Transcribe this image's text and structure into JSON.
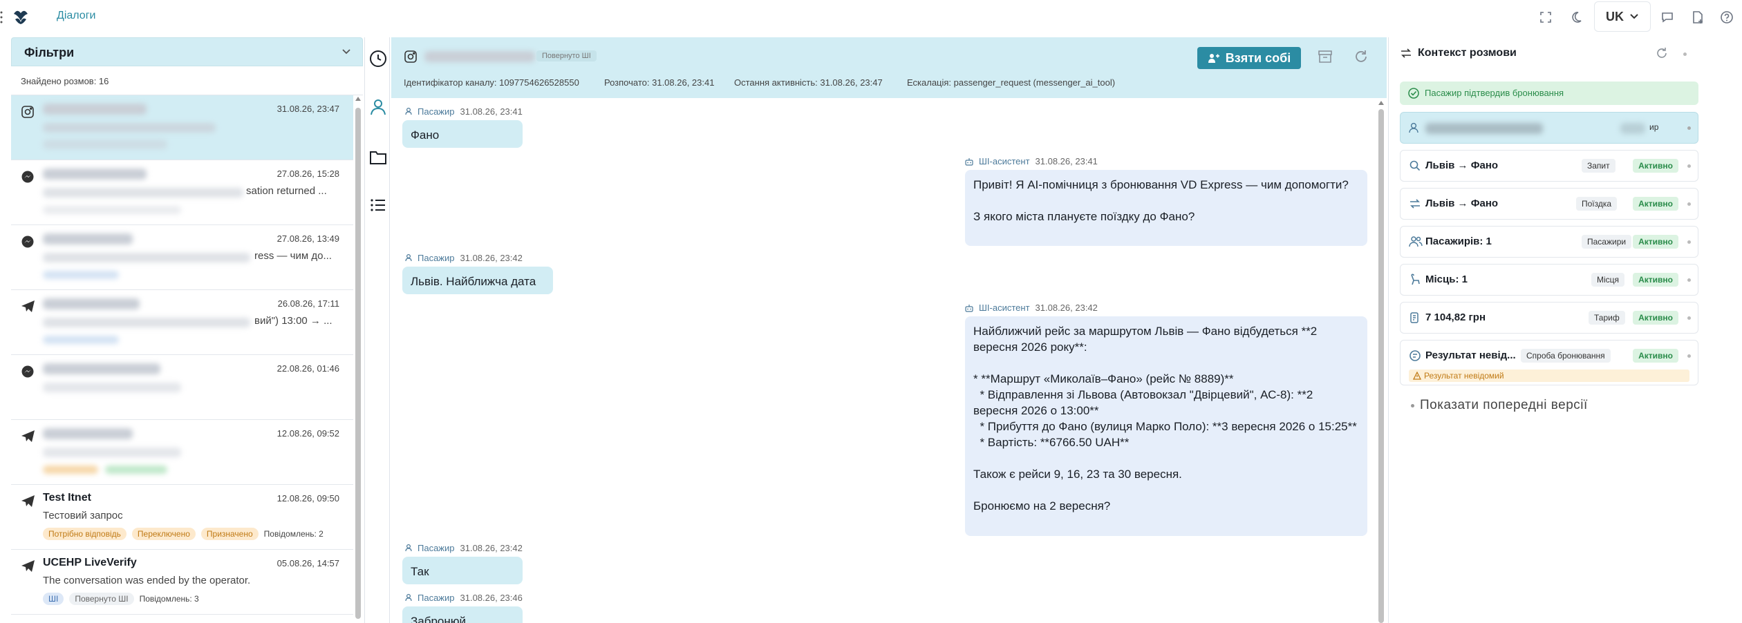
{
  "topbar": {
    "nav_label": "Діалоги",
    "lang": "UK"
  },
  "filters": {
    "title": "Фільтри",
    "found": "Знайдено розмов: 16"
  },
  "conversations": [
    {
      "name": "",
      "date": "31.08.26, 23:47",
      "preview": "",
      "channel": "instagram-icon"
    },
    {
      "name": "",
      "date": "27.08.26, 15:28",
      "preview": "sation returned ...",
      "channel": "messenger-icon"
    },
    {
      "name": "",
      "date": "27.08.26, 13:49",
      "preview": "ress — чим до...",
      "channel": "messenger-icon"
    },
    {
      "name": "",
      "date": "26.08.26, 17:11",
      "preview": "вий\") 13:00 → ...",
      "channel": "telegram-icon"
    },
    {
      "name": "",
      "date": "22.08.26, 01:46",
      "preview": "",
      "channel": "messenger-icon"
    },
    {
      "name": "",
      "date": "12.08.26, 09:52",
      "preview": "",
      "channel": "telegram-icon"
    },
    {
      "name": "Test Itnet",
      "date": "12.08.26, 09:50",
      "preview": "Тестовий запрос",
      "channel": "telegram-icon",
      "tags": [
        "Потрібно відповідь",
        "Переключено",
        "Призначено"
      ],
      "messages": "Повідомлень: 2"
    },
    {
      "name": "UCEHP LiveVerify",
      "date": "05.08.26, 14:57",
      "preview": "The conversation was ended by the operator.",
      "channel": "telegram-icon",
      "tags": [
        "ШІ",
        "Повернуто ШІ"
      ],
      "messages": "Повідомлень: 3"
    }
  ],
  "chat": {
    "returned_badge": "Повернуто ШІ",
    "take_button": "Взяти собі",
    "meta": {
      "channel_id": "Ідентифікатор каналу: 1097754626528550",
      "started": "Розпочато: 31.08.26, 23:41",
      "last_activity": "Остання активність: 31.08.26, 23:47",
      "escalation": "Ескалація: passenger_request (messenger_ai_tool)"
    },
    "messages": [
      {
        "role": "passenger",
        "sender": "Пасажир",
        "time": "31.08.26, 23:41",
        "text": "Фано"
      },
      {
        "role": "ai",
        "sender": "ШІ-асистент",
        "time": "31.08.26, 23:41",
        "text": "Привіт! Я AI-помічниця з бронювання VD Express — чим допомогти?\n\nЗ якого міста плануєте поїздку до Фано?"
      },
      {
        "role": "passenger",
        "sender": "Пасажир",
        "time": "31.08.26, 23:42",
        "text": "Львів. Найближча дата"
      },
      {
        "role": "ai",
        "sender": "ШІ-асистент",
        "time": "31.08.26, 23:42",
        "text": "Найближчий рейс за маршрутом Львів — Фано відбудеться **2 вересня 2026 року**:\n\n* **Маршрут «Миколаїв–Фано» (рейс № 8889)**\n  * Відправлення зі Львова (Автовокзал \"Двірцевий\", АС-8): **2 вересня 2026 о 13:00**\n  * Прибуття до Фано (вулиця Марко Поло): **3 вересня 2026 о 15:25**\n  * Вартість: **6766.50 UAH**\n\nТакож є рейси 9, 16, 23 та 30 вересня.\n\nБронюємо на 2 вересня?"
      },
      {
        "role": "passenger",
        "sender": "Пасажир",
        "time": "31.08.26, 23:42",
        "text": "Так"
      },
      {
        "role": "passenger",
        "sender": "Пасажир",
        "time": "31.08.26, 23:46",
        "text": "Забронюй"
      }
    ]
  },
  "context": {
    "title": "Контекст розмови",
    "confirmed": "Пасажир підтвердив бронювання",
    "person_suffix": "ир",
    "items": [
      {
        "label": "Львів → Фано",
        "type": "Запит",
        "status": "Активно",
        "icon": "search-icon"
      },
      {
        "label": "Львів → Фано",
        "type": "Поїздка",
        "status": "Активно",
        "icon": "route-icon"
      },
      {
        "label": "Пасажирів: 1",
        "type": "Пасажири",
        "status": "Активно",
        "icon": "users-icon"
      },
      {
        "label": "Місць: 1",
        "type": "Місця",
        "status": "Активно",
        "icon": "seat-icon"
      },
      {
        "label": "7 104,82 грн",
        "type": "Тариф",
        "status": "Активно",
        "icon": "fare-icon"
      },
      {
        "label": "Результат невід...",
        "type": "Спроба бронювання",
        "status": "Активно",
        "icon": "booking-icon",
        "note": "Результат невідомий"
      }
    ],
    "show_previous": "Показати попередні версії"
  },
  "colors": {
    "accent": "#2b8ca3",
    "light_blue": "#d2edf4",
    "ai_bubble": "#e6eefa",
    "active_green": "#2a8c4a"
  }
}
